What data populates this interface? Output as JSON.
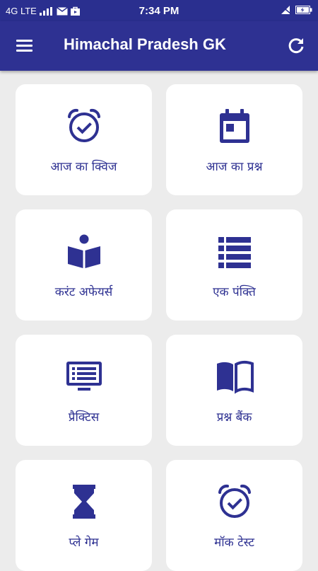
{
  "status_bar": {
    "network": "4G LTE",
    "time": "7:34 PM"
  },
  "appbar": {
    "title": "Himachal Pradesh GK",
    "menu_icon": "hamburger-menu-icon",
    "refresh_icon": "refresh-icon"
  },
  "colors": {
    "primary": "#2e3192",
    "status_bar": "#2a2f8f",
    "background": "#ececec",
    "card": "#ffffff"
  },
  "menu": [
    {
      "label": "आज का क्विज",
      "icon": "alarm-check-icon"
    },
    {
      "label": "आज का प्रश्न",
      "icon": "calendar-icon"
    },
    {
      "label": "करंट अफेयर्स",
      "icon": "reading-book-icon"
    },
    {
      "label": "एक पंक्ति",
      "icon": "list-icon"
    },
    {
      "label": "प्रैक्टिस",
      "icon": "monitor-list-icon"
    },
    {
      "label": "प्रश्न बैंक",
      "icon": "open-book-icon"
    },
    {
      "label": "प्ले गेम",
      "icon": "hourglass-icon"
    },
    {
      "label": "मॉक टेस्ट",
      "icon": "alarm-check-icon"
    }
  ]
}
